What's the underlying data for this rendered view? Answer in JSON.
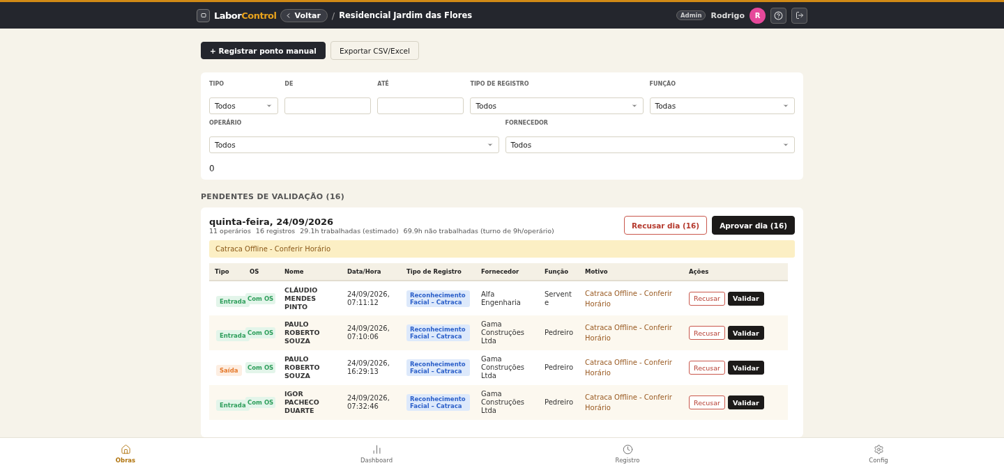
{
  "header": {
    "brand_first": "Labor",
    "brand_second": "Control",
    "back": "Voltar",
    "separator": "/",
    "title": "Residencial Jardim das Flores",
    "role": "Admin",
    "user": "Rodrigo",
    "avatar": "R"
  },
  "actions": [
    {
      "label": "+ Registrar ponto manual",
      "kind": "primary"
    },
    {
      "label": "Exportar CSV/Excel",
      "kind": "secondary"
    }
  ],
  "filters": {
    "row1": [
      {
        "label": "TIPO",
        "kind": "select",
        "value": "Todos"
      },
      {
        "label": "DE",
        "kind": "date"
      },
      {
        "label": "ATÉ",
        "kind": "date"
      },
      {
        "label": "TIPO DE REGISTRO",
        "kind": "select",
        "value": "Todos"
      },
      {
        "label": "FUNÇÃO",
        "kind": "select",
        "value": "Todas"
      }
    ],
    "row2": [
      {
        "label": "OPERÁRIO",
        "kind": "select",
        "value": "Todos"
      },
      {
        "label": "FORNECEDOR",
        "kind": "select",
        "value": "Todos"
      }
    ],
    "count": "0"
  },
  "section_title": "PENDENTES DE VALIDAÇÃO (16)",
  "day": {
    "title": "quinta-feira, 24/09/2026",
    "stats": [
      "11 operários",
      "16 registros",
      "29.1h trabalhadas (estimado)",
      "69.9h não trabalhadas (turno de 9h/operário)"
    ],
    "reject": "Recusar dia (16)",
    "approve": "Aprovar dia (16)",
    "alert": "Catraca Offline - Conferir Horário"
  },
  "table": {
    "columns": [
      "Tipo",
      "OS",
      "Nome",
      "Data/Hora",
      "Tipo de Registro",
      "Fornecedor",
      "Função",
      "Motivo",
      "Ações"
    ],
    "rows": [
      {
        "tipo": "Entrada",
        "kind": "entry",
        "os": "Com OS",
        "nome": "CLÁUDIO MENDES PINTO",
        "datahora": "24/09/2026, 07:11:12",
        "registro": "Reconhecimento Facial – Catraca",
        "fornecedor": "Alfa Engenharia",
        "funcao": "Servente",
        "motivo": "Catraca Offline - Conferir Horário",
        "reject": "Recusar",
        "validate": "Validar"
      },
      {
        "tipo": "Entrada",
        "kind": "entry",
        "os": "Com OS",
        "nome": "PAULO ROBERTO SOUZA",
        "datahora": "24/09/2026, 07:10:06",
        "registro": "Reconhecimento Facial – Catraca",
        "fornecedor": "Gama Construções Ltda",
        "funcao": "Pedreiro",
        "motivo": "Catraca Offline - Conferir Horário",
        "reject": "Recusar",
        "validate": "Validar"
      },
      {
        "tipo": "Saída",
        "kind": "exit",
        "os": "Com OS",
        "nome": "PAULO ROBERTO SOUZA",
        "datahora": "24/09/2026, 16:29:13",
        "registro": "Reconhecimento Facial – Catraca",
        "fornecedor": "Gama Construções Ltda",
        "funcao": "Pedreiro",
        "motivo": "Catraca Offline - Conferir Horário",
        "reject": "Recusar",
        "validate": "Validar"
      },
      {
        "tipo": "Entrada",
        "kind": "entry",
        "os": "Com OS",
        "nome": "IGOR PACHECO DUARTE",
        "datahora": "24/09/2026, 07:32:46",
        "registro": "Reconhecimento Facial – Catraca",
        "fornecedor": "Gama Construções Ltda",
        "funcao": "Pedreiro",
        "motivo": "Catraca Offline - Conferir Horário",
        "reject": "Recusar",
        "validate": "Validar"
      }
    ]
  },
  "nav": [
    {
      "label": "Obras",
      "selected": true
    },
    {
      "label": "Dashboard",
      "selected": false
    },
    {
      "label": "Registro",
      "selected": false
    },
    {
      "label": "Config",
      "selected": false
    }
  ]
}
